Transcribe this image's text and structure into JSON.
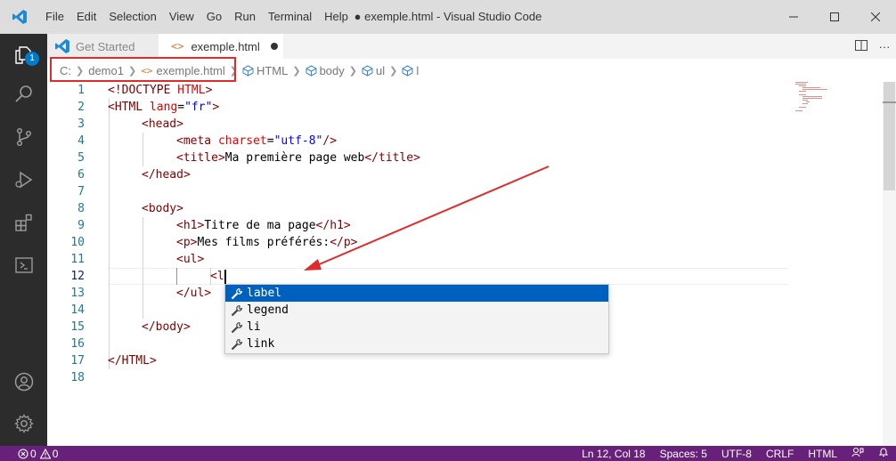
{
  "window": {
    "title": "● exemple.html - Visual Studio Code",
    "menu": [
      "File",
      "Edit",
      "Selection",
      "View",
      "Go",
      "Run",
      "Terminal",
      "Help"
    ]
  },
  "activity_bar": {
    "explorer_badge": "1",
    "icons": [
      "files-icon",
      "search-icon",
      "source-control-icon",
      "run-debug-icon",
      "extensions-icon",
      "remote-explorer-icon",
      "account-icon",
      "settings-gear-icon"
    ]
  },
  "tabs": [
    {
      "label": "Get Started",
      "active": false
    },
    {
      "label": "exemple.html",
      "active": true,
      "dirty": true
    }
  ],
  "breadcrumbs": {
    "drive": "C:",
    "folder": "demo1",
    "file": "exemple.html",
    "symbols": [
      "HTML",
      "body",
      "ul",
      "l"
    ]
  },
  "editor": {
    "line_numbers": [
      "1",
      "2",
      "3",
      "4",
      "5",
      "6",
      "7",
      "8",
      "9",
      "10",
      "11",
      "12",
      "13",
      "14",
      "15",
      "16",
      "17",
      "18"
    ],
    "active_line": "12",
    "code": {
      "l1_open": "<!DOCTYPE ",
      "l1_name": "HTML",
      "l1_close": ">",
      "l2_tag": "<HTML ",
      "l2_attr": "lang",
      "l2_eq": "=",
      "l2_val": "\"fr\"",
      "l2_close": ">",
      "l3": "<head>",
      "l4_tag": "<meta ",
      "l4_attr": "charset",
      "l4_eq": "=",
      "l4_val": "\"utf-8\"",
      "l4_close": "/>",
      "l5_open": "<title>",
      "l5_text": "Ma première page web",
      "l5_close": "</title>",
      "l6": "</head>",
      "l8": "<body>",
      "l9_open": "<h1>",
      "l9_text": "Titre de ma page",
      "l9_close": "</h1>",
      "l10_open": "<p>",
      "l10_text": "Mes films préférés:",
      "l10_close": "</p>",
      "l11": "<ul>",
      "l12": "<l",
      "l13": "</ul>",
      "l15": "</body>",
      "l17": "</HTML>"
    }
  },
  "suggestions": {
    "items": [
      "label",
      "legend",
      "li",
      "link"
    ],
    "selected_index": 0
  },
  "status_bar": {
    "errors": "0",
    "warnings": "0",
    "position": "Ln 12, Col 18",
    "spaces": "Spaces: 5",
    "encoding": "UTF-8",
    "eol": "CRLF",
    "language": "HTML"
  },
  "colors": {
    "status_bar": "#68217a",
    "activity_bar": "#2c2c2c",
    "selection": "#0060c0",
    "annotation": "#e02b2b"
  }
}
